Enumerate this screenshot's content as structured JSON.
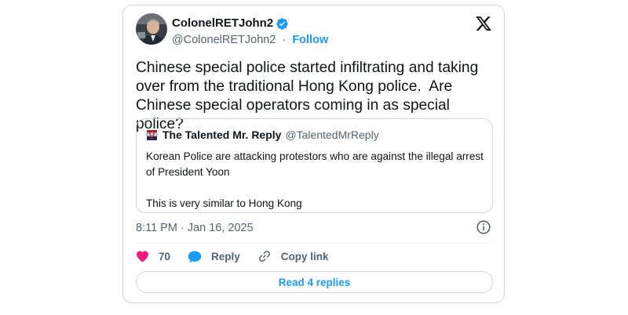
{
  "author": {
    "name": "ColonelRETJohn2",
    "handle": "@ColonelRETJohn2",
    "separator": "·",
    "follow_label": "Follow",
    "verified_icon": "verified-badge-icon"
  },
  "tweet": {
    "text": "Chinese special police started infiltrating and taking over from the traditional Hong Kong police.  Are Chinese special operators coming in as special police?",
    "timestamp": "8:11 PM · Jan 16, 2025"
  },
  "quoted_tweet": {
    "author_name": "The Talented Mr. Reply",
    "author_handle": "@TalentedMrReply",
    "text": "Korean Police are attacking protestors who are against the illegal arrest of President Yoon\n\nThis is very similar to Hong Kong"
  },
  "actions": {
    "like_count": "70",
    "reply_label": "Reply",
    "copy_link_label": "Copy link"
  },
  "read_replies_label": "Read 4 replies",
  "colors": {
    "accent": "#1d9bf0",
    "like": "#f91880",
    "text": "#0f1419",
    "muted": "#536471",
    "border": "#cfd9de"
  },
  "icons": [
    "x-logo-icon",
    "verified-badge-icon",
    "info-icon",
    "heart-icon",
    "reply-bubble-icon",
    "link-icon"
  ]
}
